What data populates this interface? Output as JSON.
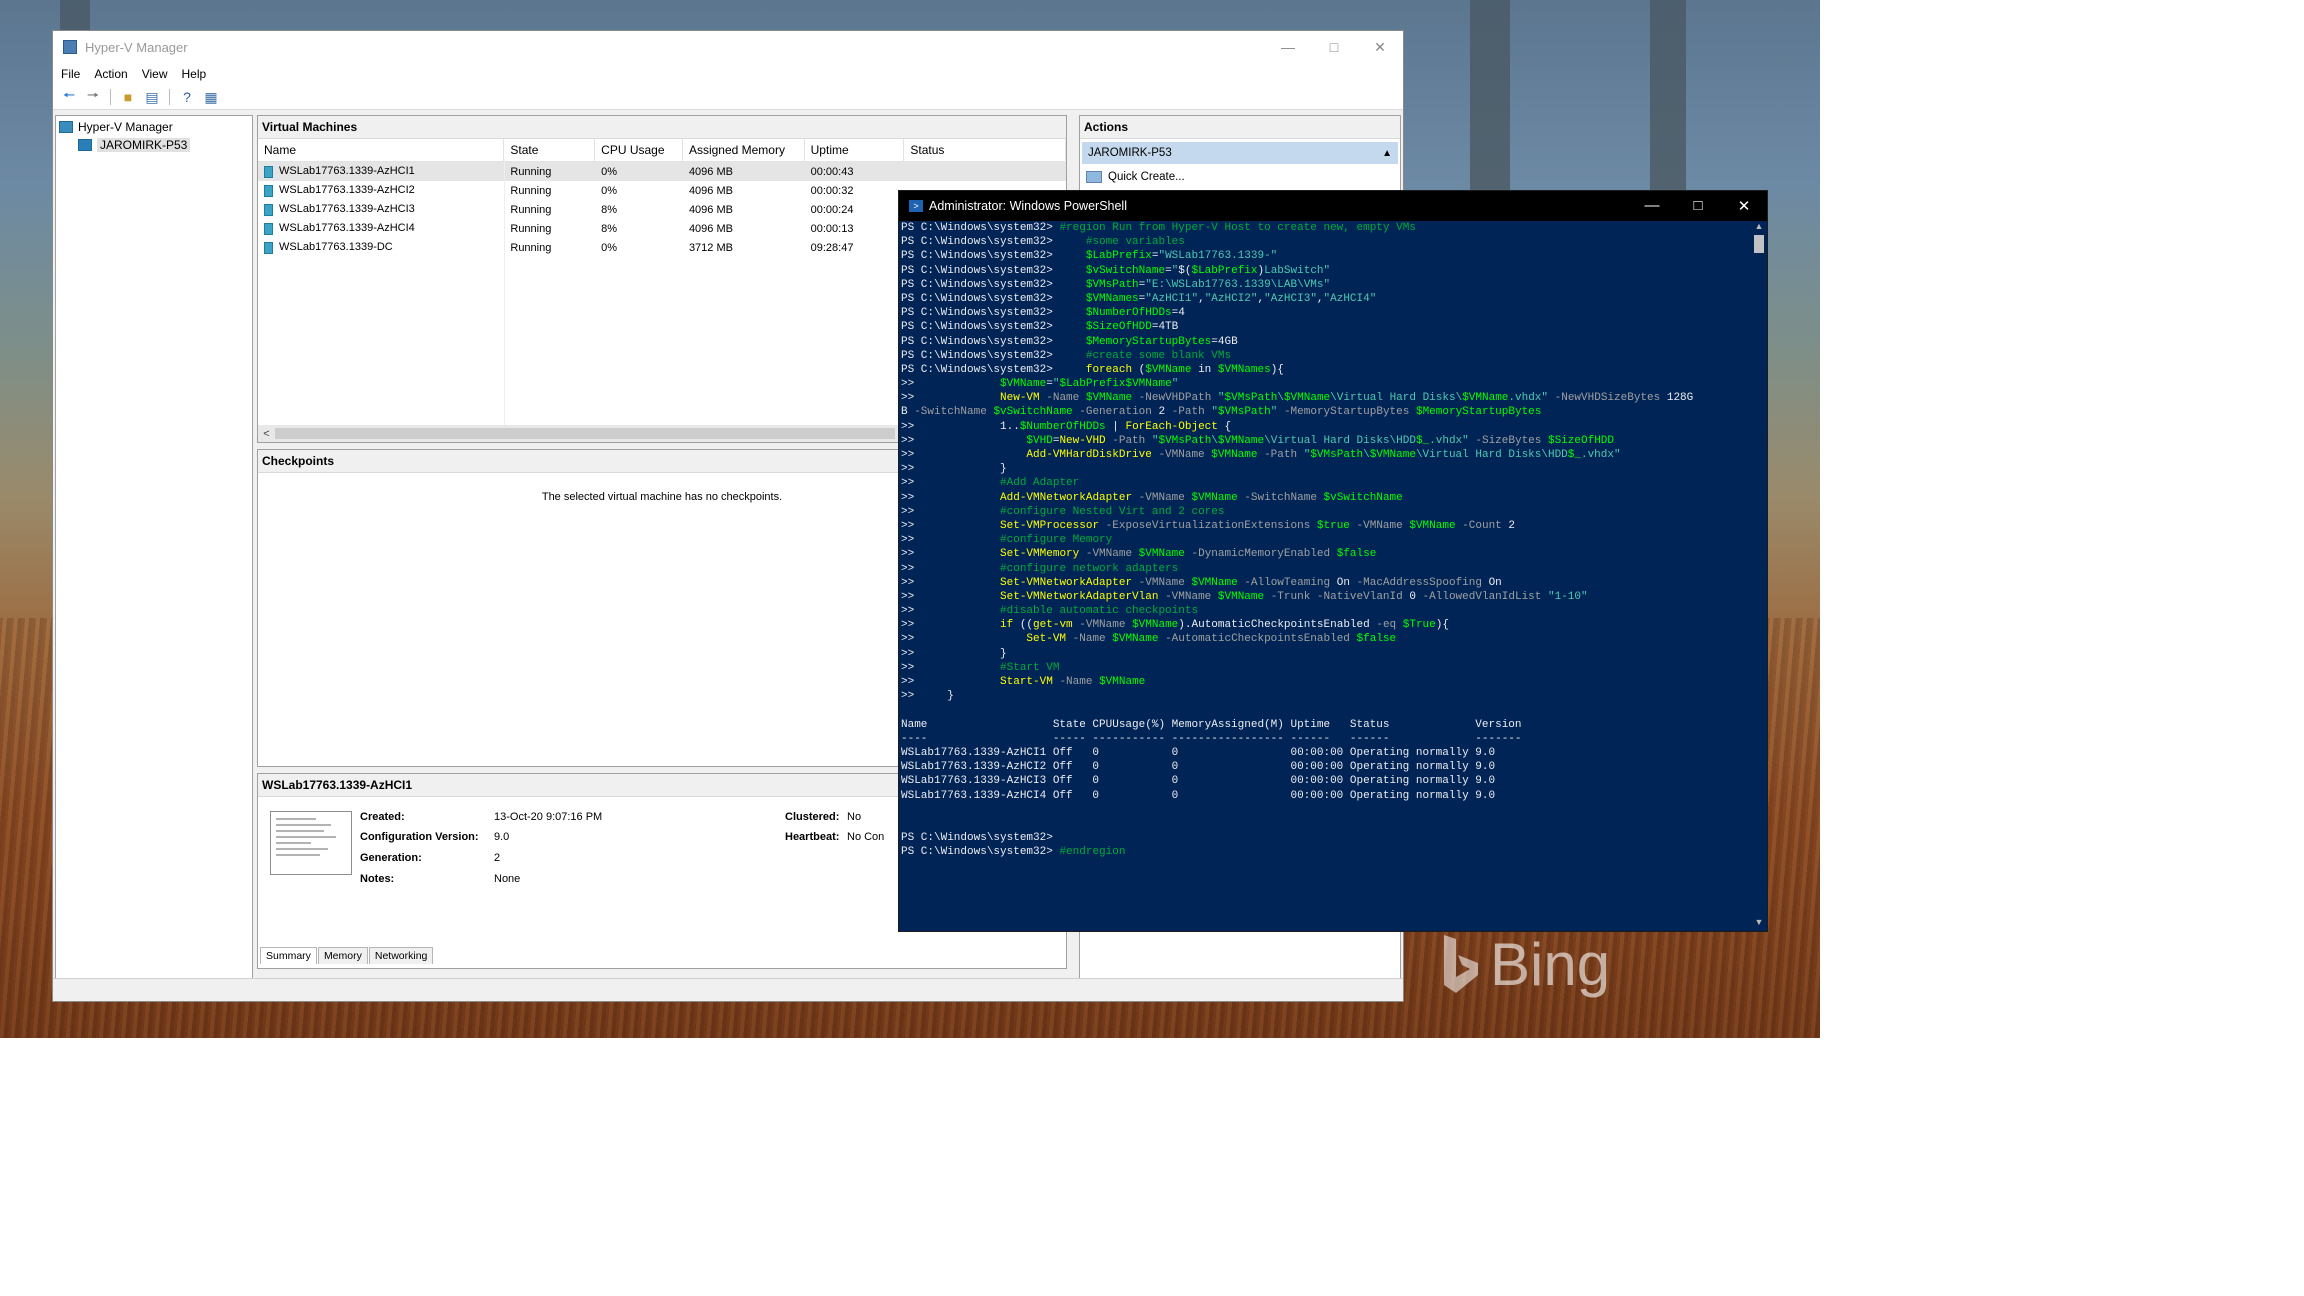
{
  "hyperv": {
    "title": "Hyper-V Manager",
    "menu": [
      "File",
      "Action",
      "View",
      "Help"
    ],
    "tree": {
      "root": "Hyper-V Manager",
      "host": "JAROMIRK-P53"
    },
    "vm_panel": {
      "title": "Virtual Machines",
      "columns": [
        "Name",
        "State",
        "CPU Usage",
        "Assigned Memory",
        "Uptime",
        "Status"
      ],
      "rows": [
        {
          "name": "WSLab17763.1339-AzHCI1",
          "state": "Running",
          "cpu": "0%",
          "mem": "4096 MB",
          "uptime": "00:00:43",
          "status": ""
        },
        {
          "name": "WSLab17763.1339-AzHCI2",
          "state": "Running",
          "cpu": "0%",
          "mem": "4096 MB",
          "uptime": "00:00:32",
          "status": ""
        },
        {
          "name": "WSLab17763.1339-AzHCI3",
          "state": "Running",
          "cpu": "8%",
          "mem": "4096 MB",
          "uptime": "00:00:24",
          "status": ""
        },
        {
          "name": "WSLab17763.1339-AzHCI4",
          "state": "Running",
          "cpu": "8%",
          "mem": "4096 MB",
          "uptime": "00:00:13",
          "status": ""
        },
        {
          "name": "WSLab17763.1339-DC",
          "state": "Running",
          "cpu": "0%",
          "mem": "3712 MB",
          "uptime": "09:28:47",
          "status": ""
        }
      ]
    },
    "checkpoints": {
      "title": "Checkpoints",
      "message": "The selected virtual machine has no checkpoints."
    },
    "details": {
      "title": "WSLab17763.1339-AzHCI1",
      "created_label": "Created:",
      "created_value": "13-Oct-20 9:07:16 PM",
      "config_label": "Configuration Version:",
      "config_value": "9.0",
      "gen_label": "Generation:",
      "gen_value": "2",
      "notes_label": "Notes:",
      "notes_value": "None",
      "clustered_label": "Clustered:",
      "clustered_value": "No",
      "heartbeat_label": "Heartbeat:",
      "heartbeat_value": "No Con",
      "tabs": [
        "Summary",
        "Memory",
        "Networking"
      ]
    },
    "actions": {
      "title": "Actions",
      "host": "JAROMIRK-P53",
      "items": [
        "Quick Create..."
      ]
    }
  },
  "powershell": {
    "title": "Administrator: Windows PowerShell",
    "lines": [
      [
        [
          "w",
          "PS C:\\Windows\\system32> "
        ],
        [
          "c",
          "#region Run from Hyper-V Host to create new, empty VMs"
        ]
      ],
      [
        [
          "w",
          "PS C:\\Windows\\system32>     "
        ],
        [
          "c",
          "#some variables"
        ]
      ],
      [
        [
          "w",
          "PS C:\\Windows\\system32>     "
        ],
        [
          "v",
          "$LabPrefix"
        ],
        [
          "w",
          "="
        ],
        [
          "s",
          "\"WSLab17763.1339-\""
        ]
      ],
      [
        [
          "w",
          "PS C:\\Windows\\system32>     "
        ],
        [
          "v",
          "$vSwitchName"
        ],
        [
          "w",
          "="
        ],
        [
          "s",
          "\""
        ],
        [
          "w",
          "$("
        ],
        [
          "v",
          "$LabPrefix"
        ],
        [
          "w",
          ")"
        ],
        [
          "s",
          "LabSwitch\""
        ]
      ],
      [
        [
          "w",
          "PS C:\\Windows\\system32>     "
        ],
        [
          "v",
          "$VMsPath"
        ],
        [
          "w",
          "="
        ],
        [
          "s",
          "\"E:\\WSLab17763.1339\\LAB\\VMs\""
        ]
      ],
      [
        [
          "w",
          "PS C:\\Windows\\system32>     "
        ],
        [
          "v",
          "$VMNames"
        ],
        [
          "w",
          "="
        ],
        [
          "s",
          "\"AzHCI1\""
        ],
        [
          "w",
          ","
        ],
        [
          "s",
          "\"AzHCI2\""
        ],
        [
          "w",
          ","
        ],
        [
          "s",
          "\"AzHCI3\""
        ],
        [
          "w",
          ","
        ],
        [
          "s",
          "\"AzHCI4\""
        ]
      ],
      [
        [
          "w",
          "PS C:\\Windows\\system32>     "
        ],
        [
          "v",
          "$NumberOfHDDs"
        ],
        [
          "w",
          "=4"
        ]
      ],
      [
        [
          "w",
          "PS C:\\Windows\\system32>     "
        ],
        [
          "v",
          "$SizeOfHDD"
        ],
        [
          "w",
          "=4TB"
        ]
      ],
      [
        [
          "w",
          "PS C:\\Windows\\system32>     "
        ],
        [
          "v",
          "$MemoryStartupBytes"
        ],
        [
          "w",
          "=4GB"
        ]
      ],
      [
        [
          "w",
          "PS C:\\Windows\\system32>     "
        ],
        [
          "c",
          "#create some blank VMs"
        ]
      ],
      [
        [
          "w",
          "PS C:\\Windows\\system32>     "
        ],
        [
          "y",
          "foreach"
        ],
        [
          "w",
          " ("
        ],
        [
          "v",
          "$VMName"
        ],
        [
          "w",
          " in "
        ],
        [
          "v",
          "$VMNames"
        ],
        [
          "w",
          "){"
        ]
      ],
      [
        [
          "w",
          ">>             "
        ],
        [
          "v",
          "$VMName"
        ],
        [
          "w",
          "="
        ],
        [
          "s",
          "\""
        ],
        [
          "v",
          "$LabPrefix$VMName"
        ],
        [
          "s",
          "\""
        ]
      ],
      [
        [
          "w",
          ">>             "
        ],
        [
          "y",
          "New-VM"
        ],
        [
          "g",
          " -Name "
        ],
        [
          "v",
          "$VMName"
        ],
        [
          "g",
          " -NewVHDPath "
        ],
        [
          "s",
          "\""
        ],
        [
          "v",
          "$VMsPath"
        ],
        [
          "s",
          "\\"
        ],
        [
          "v",
          "$VMName"
        ],
        [
          "s",
          "\\Virtual Hard Disks\\"
        ],
        [
          "v",
          "$VMName"
        ],
        [
          "s",
          ".vhdx\""
        ],
        [
          "g",
          " -NewVHDSizeBytes "
        ],
        [
          "w",
          "128G"
        ]
      ],
      [
        [
          "w",
          "B"
        ],
        [
          "g",
          " -SwitchName "
        ],
        [
          "v",
          "$vSwitchName"
        ],
        [
          "g",
          " -Generation "
        ],
        [
          "w",
          "2"
        ],
        [
          "g",
          " -Path "
        ],
        [
          "s",
          "\""
        ],
        [
          "v",
          "$VMsPath"
        ],
        [
          "s",
          "\""
        ],
        [
          "g",
          " -MemoryStartupBytes "
        ],
        [
          "v",
          "$MemoryStartupBytes"
        ]
      ],
      [
        [
          "w",
          ">>             1.."
        ],
        [
          "v",
          "$NumberOfHDDs"
        ],
        [
          "w",
          " | "
        ],
        [
          "y",
          "ForEach-Object"
        ],
        [
          "w",
          " {"
        ]
      ],
      [
        [
          "w",
          ">>                 "
        ],
        [
          "v",
          "$VHD"
        ],
        [
          "w",
          "="
        ],
        [
          "y",
          "New-VHD"
        ],
        [
          "g",
          " -Path "
        ],
        [
          "s",
          "\""
        ],
        [
          "v",
          "$VMsPath"
        ],
        [
          "s",
          "\\"
        ],
        [
          "v",
          "$VMName"
        ],
        [
          "s",
          "\\Virtual Hard Disks\\HDD"
        ],
        [
          "v",
          "$_"
        ],
        [
          "s",
          ".vhdx\""
        ],
        [
          "g",
          " -SizeBytes "
        ],
        [
          "v",
          "$SizeOfHDD"
        ]
      ],
      [
        [
          "w",
          ">>                 "
        ],
        [
          "y",
          "Add-VMHardDiskDrive"
        ],
        [
          "g",
          " -VMName "
        ],
        [
          "v",
          "$VMName"
        ],
        [
          "g",
          " -Path "
        ],
        [
          "s",
          "\""
        ],
        [
          "v",
          "$VMsPath"
        ],
        [
          "s",
          "\\"
        ],
        [
          "v",
          "$VMName"
        ],
        [
          "s",
          "\\Virtual Hard Disks\\HDD"
        ],
        [
          "v",
          "$_"
        ],
        [
          "s",
          ".vhdx\""
        ]
      ],
      [
        [
          "w",
          ">>             }"
        ]
      ],
      [
        [
          "w",
          ">>             "
        ],
        [
          "c",
          "#Add Adapter"
        ]
      ],
      [
        [
          "w",
          ">>             "
        ],
        [
          "y",
          "Add-VMNetworkAdapter"
        ],
        [
          "g",
          " -VMName "
        ],
        [
          "v",
          "$VMName"
        ],
        [
          "g",
          " -SwitchName "
        ],
        [
          "v",
          "$vSwitchName"
        ]
      ],
      [
        [
          "w",
          ">>             "
        ],
        [
          "c",
          "#configure Nested Virt and 2 cores"
        ]
      ],
      [
        [
          "w",
          ">>             "
        ],
        [
          "y",
          "Set-VMProcessor"
        ],
        [
          "g",
          " -ExposeVirtualizationExtensions "
        ],
        [
          "v",
          "$true"
        ],
        [
          "g",
          " -VMName "
        ],
        [
          "v",
          "$VMName"
        ],
        [
          "g",
          " -Count "
        ],
        [
          "w",
          "2"
        ]
      ],
      [
        [
          "w",
          ">>             "
        ],
        [
          "c",
          "#configure Memory"
        ]
      ],
      [
        [
          "w",
          ">>             "
        ],
        [
          "y",
          "Set-VMMemory"
        ],
        [
          "g",
          " -VMName "
        ],
        [
          "v",
          "$VMName"
        ],
        [
          "g",
          " -DynamicMemoryEnabled "
        ],
        [
          "v",
          "$false"
        ]
      ],
      [
        [
          "w",
          ">>             "
        ],
        [
          "c",
          "#configure network adapters"
        ]
      ],
      [
        [
          "w",
          ">>             "
        ],
        [
          "y",
          "Set-VMNetworkAdapter"
        ],
        [
          "g",
          " -VMName "
        ],
        [
          "v",
          "$VMName"
        ],
        [
          "g",
          " -AllowTeaming "
        ],
        [
          "w",
          "On"
        ],
        [
          "g",
          " -MacAddressSpoofing "
        ],
        [
          "w",
          "On"
        ]
      ],
      [
        [
          "w",
          ">>             "
        ],
        [
          "y",
          "Set-VMNetworkAdapterVlan"
        ],
        [
          "g",
          " -VMName "
        ],
        [
          "v",
          "$VMName"
        ],
        [
          "g",
          " -Trunk -NativeVlanId "
        ],
        [
          "w",
          "0"
        ],
        [
          "g",
          " -AllowedVlanIdList "
        ],
        [
          "s",
          "\"1-10\""
        ]
      ],
      [
        [
          "w",
          ">>             "
        ],
        [
          "c",
          "#disable automatic checkpoints"
        ]
      ],
      [
        [
          "w",
          ">>             "
        ],
        [
          "y",
          "if"
        ],
        [
          "w",
          " (("
        ],
        [
          "y",
          "get-vm"
        ],
        [
          "g",
          " -VMName "
        ],
        [
          "v",
          "$VMName"
        ],
        [
          "w",
          ").AutomaticCheckpointsEnabled "
        ],
        [
          "g",
          "-eq "
        ],
        [
          "v",
          "$True"
        ],
        [
          "w",
          "){"
        ]
      ],
      [
        [
          "w",
          ">>                 "
        ],
        [
          "y",
          "Set-VM"
        ],
        [
          "g",
          " -Name "
        ],
        [
          "v",
          "$VMName"
        ],
        [
          "g",
          " -AutomaticCheckpointsEnabled "
        ],
        [
          "v",
          "$false"
        ]
      ],
      [
        [
          "w",
          ">>             }"
        ]
      ],
      [
        [
          "w",
          ">>             "
        ],
        [
          "c",
          "#Start VM"
        ]
      ],
      [
        [
          "w",
          ">>             "
        ],
        [
          "y",
          "Start-VM"
        ],
        [
          "g",
          " -Name "
        ],
        [
          "v",
          "$VMName"
        ]
      ],
      [
        [
          "w",
          ">>     }"
        ]
      ],
      [
        [
          "w",
          ""
        ]
      ],
      [
        [
          "w",
          "Name                   State CPUUsage(%) MemoryAssigned(M) Uptime   Status             Version"
        ]
      ],
      [
        [
          "w",
          "----                   ----- ----------- ----------------- ------   ------             -------"
        ]
      ],
      [
        [
          "w",
          "WSLab17763.1339-AzHCI1 Off   0           0                 00:00:00 Operating normally 9.0"
        ]
      ],
      [
        [
          "w",
          "WSLab17763.1339-AzHCI2 Off   0           0                 00:00:00 Operating normally 9.0"
        ]
      ],
      [
        [
          "w",
          "WSLab17763.1339-AzHCI3 Off   0           0                 00:00:00 Operating normally 9.0"
        ]
      ],
      [
        [
          "w",
          "WSLab17763.1339-AzHCI4 Off   0           0                 00:00:00 Operating normally 9.0"
        ]
      ],
      [
        [
          "w",
          ""
        ]
      ],
      [
        [
          "w",
          ""
        ]
      ],
      [
        [
          "w",
          "PS C:\\Windows\\system32>"
        ]
      ],
      [
        [
          "w",
          "PS C:\\Windows\\system32> "
        ],
        [
          "c",
          "#endregion"
        ]
      ]
    ]
  },
  "desktop": {
    "bing": "Bing"
  }
}
